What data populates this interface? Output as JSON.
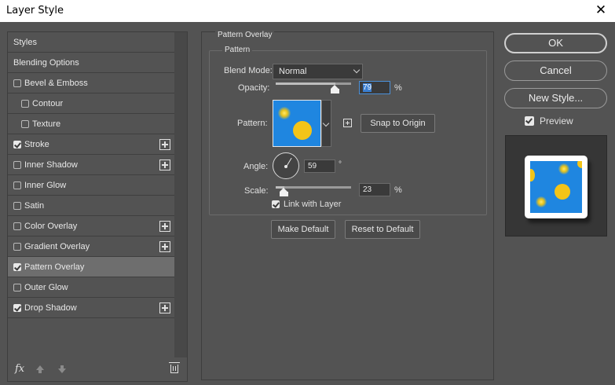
{
  "window": {
    "title": "Layer Style",
    "close_glyph": "✕"
  },
  "styles_panel": {
    "items": [
      {
        "label": "Styles",
        "has_checkbox": false,
        "checked": false,
        "has_plus": false,
        "indent": false,
        "selected": false
      },
      {
        "label": "Blending Options",
        "has_checkbox": false,
        "checked": false,
        "has_plus": false,
        "indent": false,
        "selected": false
      },
      {
        "label": "Bevel & Emboss",
        "has_checkbox": true,
        "checked": false,
        "has_plus": false,
        "indent": false,
        "selected": false
      },
      {
        "label": "Contour",
        "has_checkbox": true,
        "checked": false,
        "has_plus": false,
        "indent": true,
        "selected": false
      },
      {
        "label": "Texture",
        "has_checkbox": true,
        "checked": false,
        "has_plus": false,
        "indent": true,
        "selected": false
      },
      {
        "label": "Stroke",
        "has_checkbox": true,
        "checked": true,
        "has_plus": true,
        "indent": false,
        "selected": false
      },
      {
        "label": "Inner Shadow",
        "has_checkbox": true,
        "checked": false,
        "has_plus": true,
        "indent": false,
        "selected": false
      },
      {
        "label": "Inner Glow",
        "has_checkbox": true,
        "checked": false,
        "has_plus": false,
        "indent": false,
        "selected": false
      },
      {
        "label": "Satin",
        "has_checkbox": true,
        "checked": false,
        "has_plus": false,
        "indent": false,
        "selected": false
      },
      {
        "label": "Color Overlay",
        "has_checkbox": true,
        "checked": false,
        "has_plus": true,
        "indent": false,
        "selected": false
      },
      {
        "label": "Gradient Overlay",
        "has_checkbox": true,
        "checked": false,
        "has_plus": true,
        "indent": false,
        "selected": false
      },
      {
        "label": "Pattern Overlay",
        "has_checkbox": true,
        "checked": true,
        "has_plus": false,
        "indent": false,
        "selected": true
      },
      {
        "label": "Outer Glow",
        "has_checkbox": true,
        "checked": false,
        "has_plus": false,
        "indent": false,
        "selected": false
      },
      {
        "label": "Drop Shadow",
        "has_checkbox": true,
        "checked": true,
        "has_plus": true,
        "indent": false,
        "selected": false
      }
    ],
    "footer": {
      "fx_label": "fx",
      "fx_icon": "fx-icon",
      "up_icon": "move-up-icon",
      "down_icon": "move-down-icon",
      "delete_icon": "trash-icon"
    }
  },
  "pattern_overlay": {
    "group_title": "Pattern Overlay",
    "subgroup_title": "Pattern",
    "blend_mode_label": "Blend Mode:",
    "blend_mode_value": "Normal",
    "opacity_label": "Opacity:",
    "opacity_value": "79",
    "opacity_unit": "%",
    "opacity_level": 0.79,
    "pattern_label": "Pattern:",
    "snap_button": "Snap to Origin",
    "angle_label": "Angle:",
    "angle_value": "59",
    "angle_unit": "°",
    "scale_label": "Scale:",
    "scale_value": "23",
    "scale_unit": "%",
    "scale_level": 0.11,
    "link_label": "Link with Layer",
    "link_checked": true,
    "make_default_button": "Make Default",
    "reset_default_button": "Reset to Default"
  },
  "actions": {
    "ok": "OK",
    "cancel": "Cancel",
    "new_style": "New Style...",
    "preview_label": "Preview",
    "preview_checked": true
  },
  "colors": {
    "dialog_bg": "#535353",
    "pattern_blue": "#1f86e0",
    "pattern_yellow": "#f3c418",
    "focus_blue": "#3b7fd1"
  }
}
